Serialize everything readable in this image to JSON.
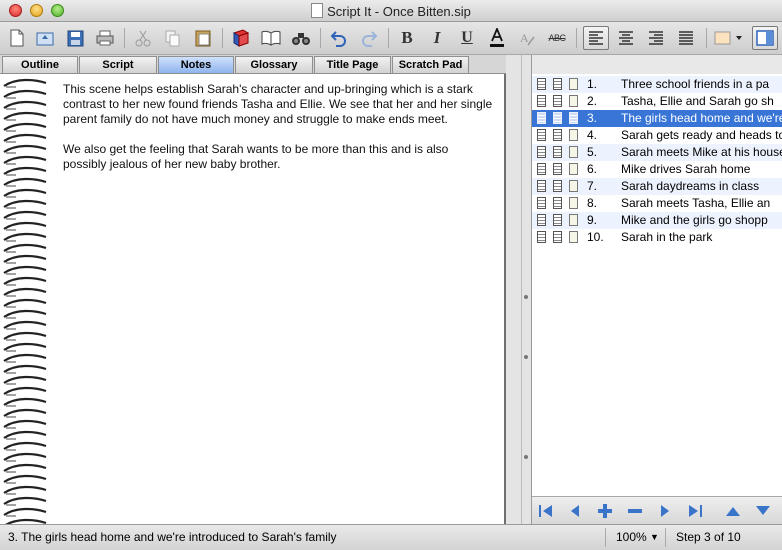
{
  "window": {
    "title": "Script It - Once Bitten.sip"
  },
  "toolbar": {
    "icons": [
      "new-document-icon",
      "open-icon",
      "save-icon",
      "print-icon",
      "cut-icon",
      "copy-icon",
      "paste-icon",
      "book-red-icon",
      "book-icon",
      "binoculars-icon",
      "undo-icon",
      "redo-icon",
      "bold-icon",
      "italic-icon",
      "underline-icon",
      "font-color-icon",
      "clear-format-icon",
      "strikethrough-icon",
      "align-left-icon",
      "align-center-icon",
      "align-right-icon",
      "justify-icon",
      "highlight-color-icon",
      "toggle-sidebar-icon"
    ],
    "strike_label": "ABC"
  },
  "tabs": [
    {
      "label": "Outline"
    },
    {
      "label": "Script"
    },
    {
      "label": "Notes",
      "active": true
    },
    {
      "label": "Glossary"
    },
    {
      "label": "Title Page"
    },
    {
      "label": "Scratch Pad"
    }
  ],
  "notes": {
    "paragraphs": [
      "This scene helps establish Sarah's character and up-bringing which is a stark contrast to her new found friends Tasha and Ellie.  We see that her and her single parent family do not have much money and struggle to make ends meet.",
      "We also get the feeling that Sarah wants to be more than this and is also possibly jealous of her new baby brother."
    ]
  },
  "scenes": [
    {
      "num": "1.",
      "text": "Three school friends in a pa"
    },
    {
      "num": "2.",
      "text": "Tasha, Ellie and Sarah go sh"
    },
    {
      "num": "3.",
      "text": "The girls head home and we're in",
      "selected": true
    },
    {
      "num": "4.",
      "text": "Sarah gets ready and heads to pa"
    },
    {
      "num": "5.",
      "text": "Sarah meets Mike at his house pa"
    },
    {
      "num": "6.",
      "text": "Mike drives Sarah home"
    },
    {
      "num": "7.",
      "text": "Sarah daydreams in class"
    },
    {
      "num": "8.",
      "text": "Sarah meets Tasha, Ellie an"
    },
    {
      "num": "9.",
      "text": "Mike and the girls go shopp"
    },
    {
      "num": "10.",
      "text": "Sarah in the park"
    }
  ],
  "scene_nav": [
    "first-scene-icon",
    "previous-scene-icon",
    "add-scene-icon",
    "remove-scene-icon",
    "next-scene-icon",
    "last-scene-icon",
    "move-up-icon",
    "move-down-icon"
  ],
  "status": {
    "current_scene": "3.  The girls head home and we're introduced to Sarah's family",
    "zoom": "100%",
    "step": "Step 3 of 10"
  },
  "colors": {
    "selection": "#3875d7",
    "active_tab": "#8fb5ee",
    "nav_accent": "#3a74c9"
  }
}
